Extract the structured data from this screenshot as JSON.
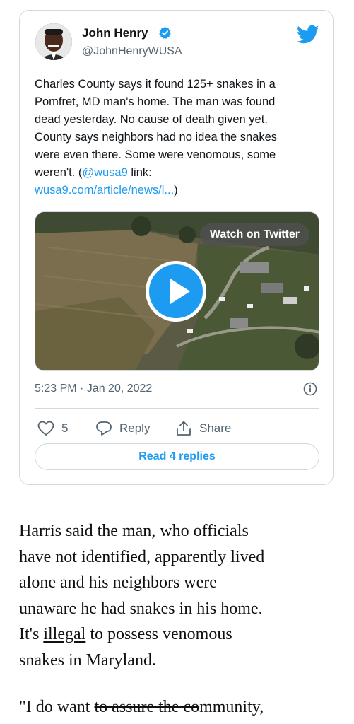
{
  "tweet": {
    "author_name": "John Henry",
    "handle": "@JohnHenryWUSA",
    "text_lines": [
      "Charles County says it found 125+ snakes in a",
      "Pomfret, MD man's home. The man was found",
      "dead yesterday. No cause of death given yet.",
      "County says neighbors had no idea the snakes",
      "were even there. Some were venomous, some"
    ],
    "line6_prefix": "weren't. (",
    "mention": "@wusa9",
    "line6_suffix": " link:",
    "link_text": "wusa9.com/article/news/l...",
    "link_close": ")",
    "watch_label": "Watch on Twitter",
    "timestamp": "5:23 PM · Jan 20, 2022",
    "like_count": "5",
    "reply_label": "Reply",
    "share_label": "Share",
    "read_replies_label": "Read 4 replies"
  },
  "article": {
    "lines": [
      "Harris said the man, who officials",
      "have not identified, apparently lived",
      "alone and his neighbors were",
      "unaware he had snakes in his home."
    ],
    "line5_prefix": "It's ",
    "line5_link": "illegal",
    "line5_suffix": " to possess venomous",
    "line6": "snakes in Maryland.",
    "quote_start": "\"I do want ",
    "quote_strike": "to assure the co",
    "quote_end": "mmunity,"
  },
  "colors": {
    "accent": "#1d9bf0",
    "text": "#0f1419",
    "muted": "#536471",
    "border": "#cfd9de"
  },
  "icons": [
    "verified-badge-icon",
    "twitter-bird-icon",
    "play-icon",
    "info-icon",
    "heart-icon",
    "reply-icon",
    "share-icon"
  ]
}
